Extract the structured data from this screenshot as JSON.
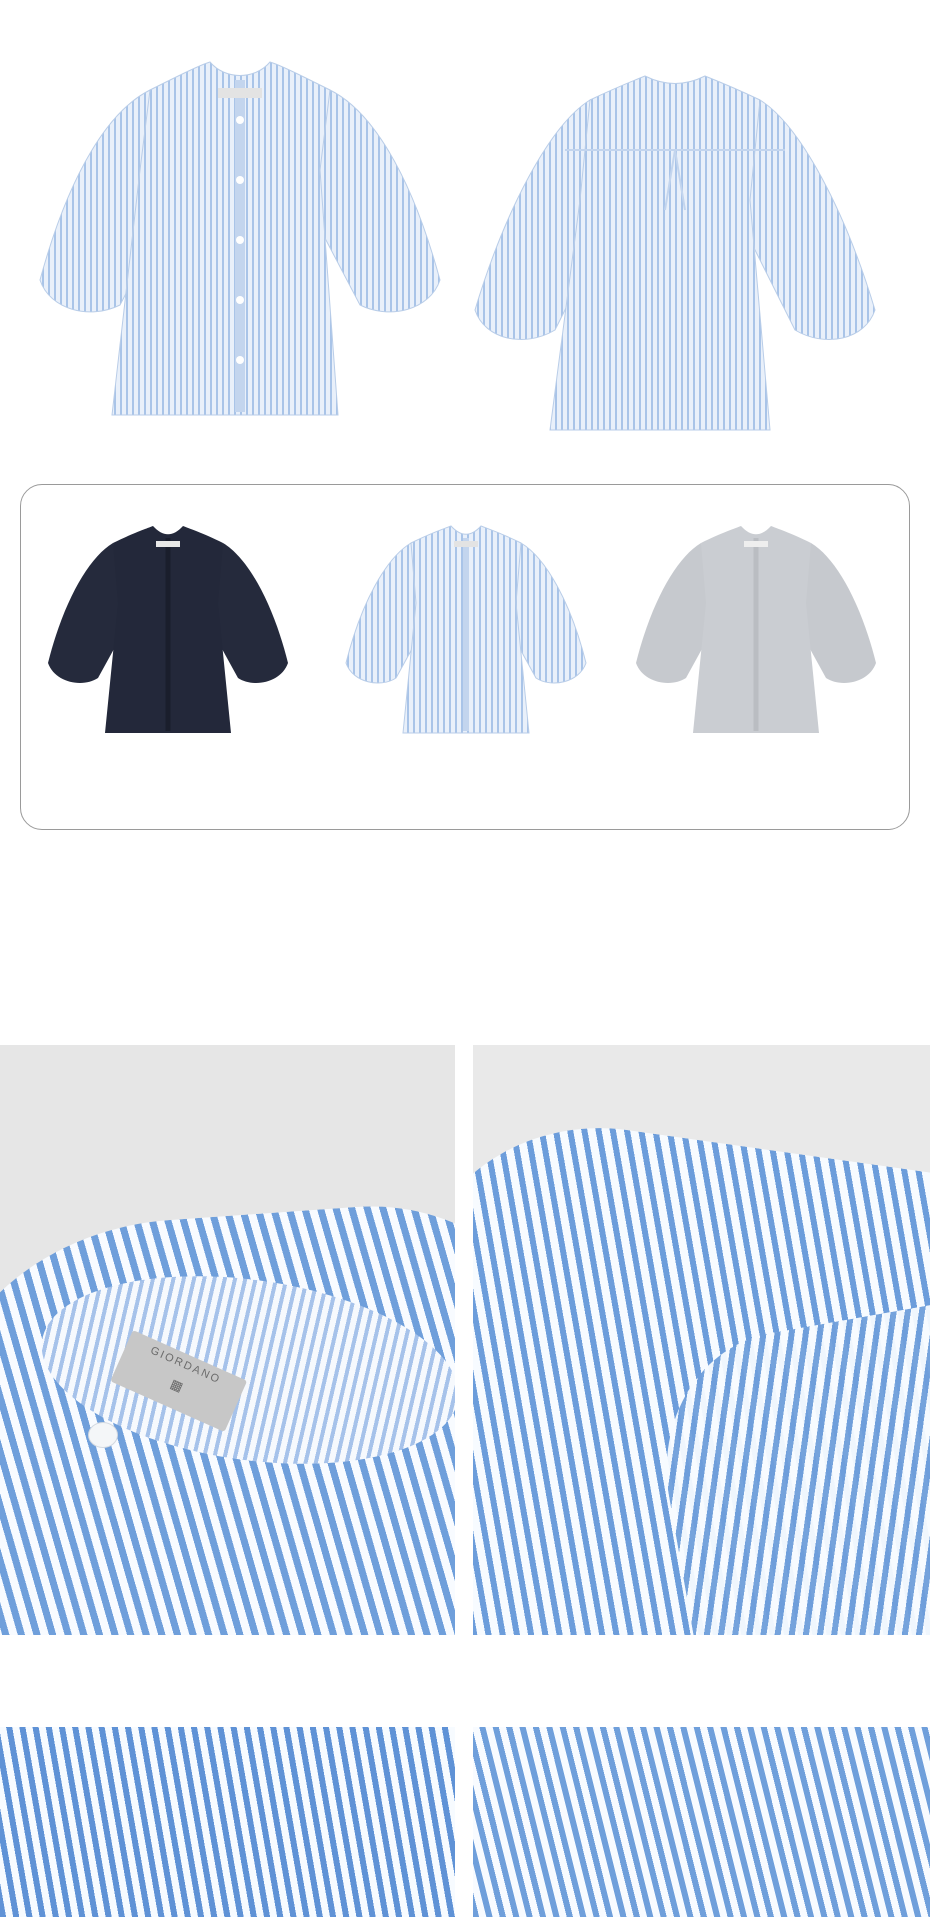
{
  "brand_label": {
    "name": "GIORDANO"
  },
  "colors": {
    "background": "#ffffff",
    "swatch_border": "#9a9a9a",
    "stripe_blue": "#6f9fdb",
    "stripe_light_blue": "#aac6ea",
    "navy": "#23283a",
    "grey": "#c9ccd1",
    "studio_grey": "#e6e6e6"
  },
  "sections": [
    "product-front-back-view",
    "color-swatch-panel",
    "detail-closeups",
    "fabric-closeups"
  ],
  "swatches": [
    "navy-blouse",
    "blue-stripe-blouse",
    "grey-blouse"
  ]
}
